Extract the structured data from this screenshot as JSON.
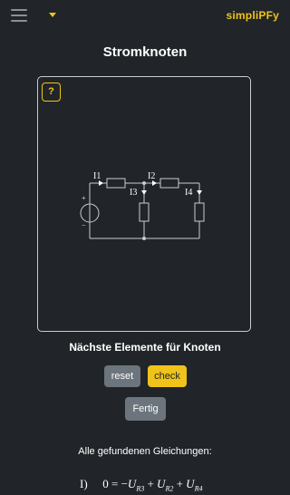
{
  "header": {
    "menu_icon": "hamburger-menu-icon",
    "dropdown_icon": "caret-down-icon",
    "brand": "simpliPFy",
    "accent_color": "#f0c31b"
  },
  "page": {
    "title": "Stromknoten"
  },
  "panel": {
    "help_label": "?",
    "circuit_labels": {
      "i1": "I1",
      "i2": "I2",
      "i3": "I3",
      "i4": "I4",
      "plus": "+",
      "minus": "−"
    }
  },
  "controls": {
    "heading": "Nächste Elemente für Knoten",
    "reset_label": "reset",
    "check_label": "check",
    "done_label": "Fertig"
  },
  "equations": {
    "heading": "Alle gefundenen Gleichungen:",
    "items": [
      {
        "index": "I)",
        "lhs": "0 = −",
        "t1": "U",
        "s1": "R3",
        "t2": "U",
        "s2": "R2",
        "t3": "U",
        "s3": "R4"
      }
    ]
  }
}
